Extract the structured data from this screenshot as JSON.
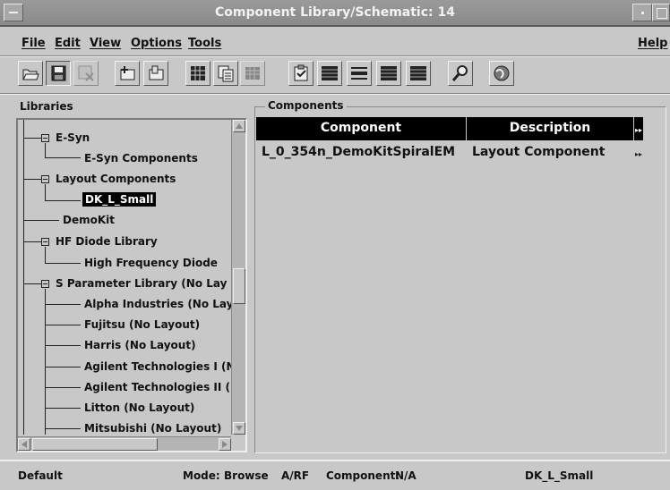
{
  "window": {
    "title": "Component Library/Schematic: 14"
  },
  "menu": {
    "file": "File",
    "edit": "Edit",
    "view": "View",
    "options": "Options",
    "tools": "Tools",
    "help": "Help"
  },
  "toolbar_icons": [
    "open-folder-icon",
    "save-icon",
    "close-window-icon",
    "add-library-icon",
    "library-icon",
    "component-grid-icon",
    "copy-icon",
    "table-icon",
    "edit-clipboard-icon",
    "list-icon",
    "minus-icon",
    "list-icon",
    "list-icon",
    "search-icon",
    "globe-icon"
  ],
  "libraries": {
    "label": "Libraries",
    "items": [
      {
        "label": "E-Syn",
        "level": 1,
        "expander": true
      },
      {
        "label": "E-Syn Components",
        "level": 2
      },
      {
        "label": "Layout Components",
        "level": 1,
        "expander": true
      },
      {
        "label": "DK_L_Small",
        "level": 2,
        "selected": true
      },
      {
        "label": "DemoKit",
        "level": 1
      },
      {
        "label": "HF Diode Library",
        "level": 1,
        "expander": true
      },
      {
        "label": "High Frequency Diode",
        "level": 2
      },
      {
        "label": "S Parameter Library (No Lay",
        "level": 1,
        "expander": true
      },
      {
        "label": "Alpha Industries (No Layo",
        "level": 2
      },
      {
        "label": "Fujitsu (No Layout)",
        "level": 2
      },
      {
        "label": "Harris (No Layout)",
        "level": 2
      },
      {
        "label": "Agilent Technologies I (N",
        "level": 2
      },
      {
        "label": "Agilent Technologies II (N",
        "level": 2
      },
      {
        "label": "Litton (No Layout)",
        "level": 2
      },
      {
        "label": "Mitsubishi (No Layout)",
        "level": 2
      }
    ]
  },
  "components": {
    "label": "Components",
    "columns": [
      "Component",
      "Description"
    ],
    "rows": [
      {
        "component": "L_0_354n_DemoKitSpiralEM",
        "description": "Layout Component"
      }
    ]
  },
  "status": {
    "mode_left": "Default",
    "mode_label": "Mode:",
    "mode_value": "Browse",
    "domain": "A/RF",
    "component_label": "Component:",
    "component_value": "N/A",
    "selection": "DK_L_Small"
  },
  "colors": {
    "background": "#c8c8c8",
    "titlebar": "#8f8f8f",
    "header": "#000000",
    "selected": "#000000"
  }
}
